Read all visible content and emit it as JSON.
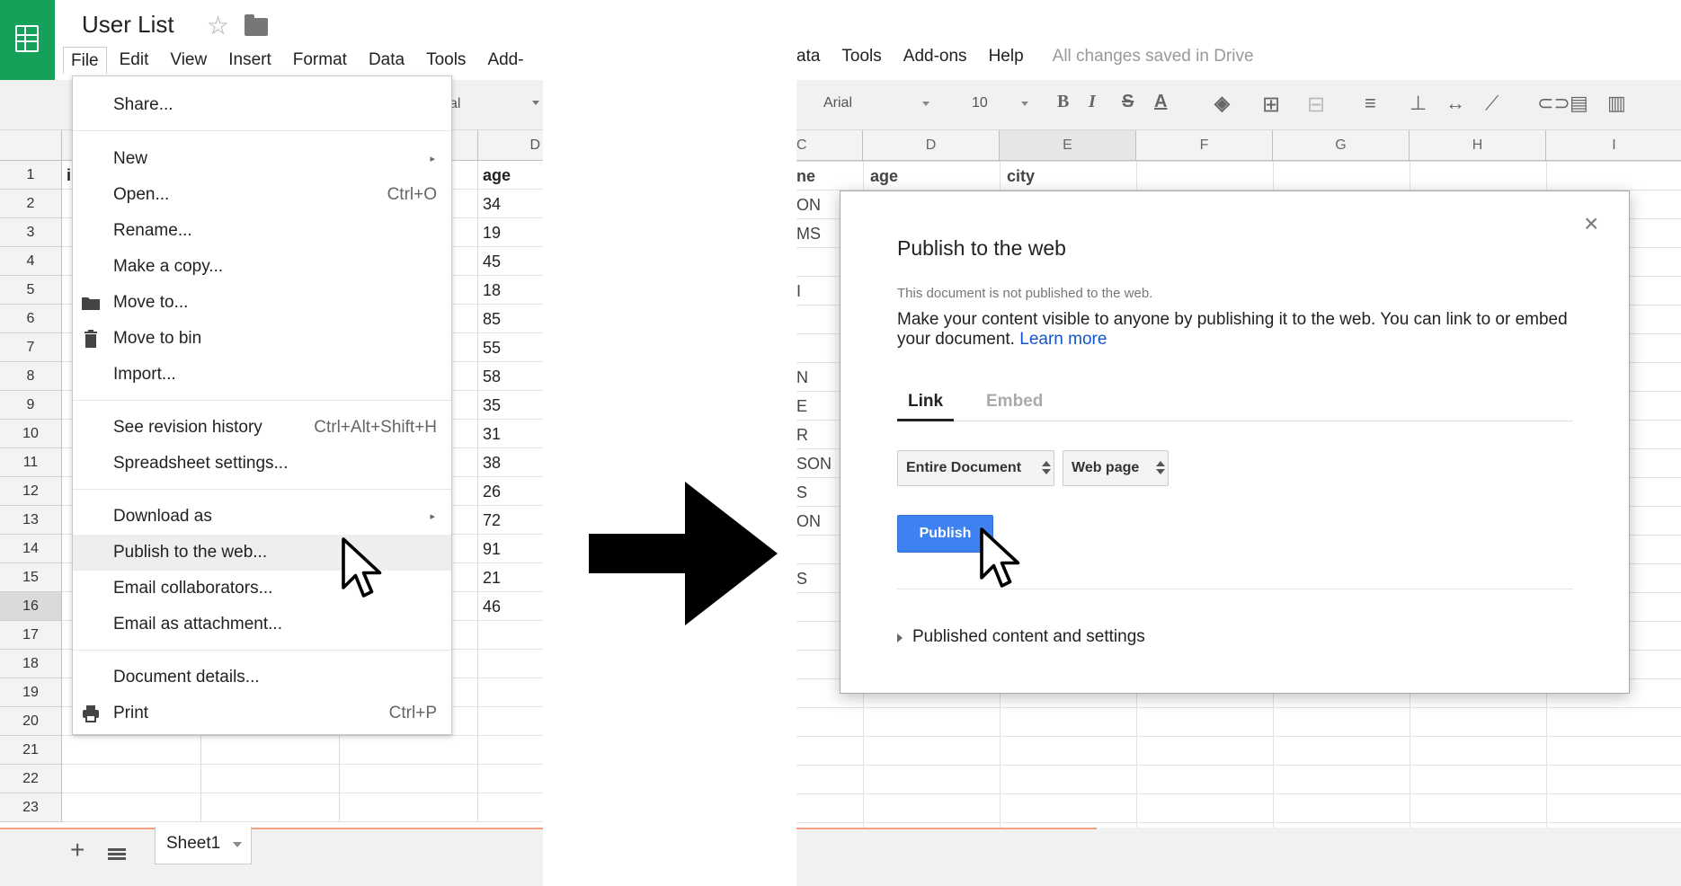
{
  "left": {
    "doc_title": "User List",
    "menubar": [
      "File",
      "Edit",
      "View",
      "Insert",
      "Format",
      "Data",
      "Tools",
      "Add-"
    ],
    "font_fragment": "al",
    "col_d_header": "D",
    "row_numbers": [
      "1",
      "2",
      "3",
      "4",
      "5",
      "6",
      "7",
      "8",
      "9",
      "10",
      "11",
      "12",
      "13",
      "14",
      "15",
      "16",
      "17",
      "18",
      "19",
      "20",
      "21",
      "22",
      "23"
    ],
    "col_a_fragment": "i",
    "age_header": "age",
    "ages": [
      "34",
      "19",
      "45",
      "18",
      "85",
      "55",
      "58",
      "35",
      "31",
      "38",
      "26",
      "72",
      "91",
      "21",
      "46"
    ],
    "sheet_tab": "Sheet1",
    "file_menu": {
      "share": "Share...",
      "new": "New",
      "open": "Open...",
      "open_shortcut": "Ctrl+O",
      "rename": "Rename...",
      "make_copy": "Make a copy...",
      "move_to": "Move to...",
      "move_to_bin": "Move to bin",
      "import": "Import...",
      "revision_history": "See revision history",
      "revision_shortcut": "Ctrl+Alt+Shift+H",
      "spreadsheet_settings": "Spreadsheet settings...",
      "download_as": "Download as",
      "publish": "Publish to the web...",
      "email_collaborators": "Email collaborators...",
      "email_attachment": "Email as attachment...",
      "document_details": "Document details...",
      "print": "Print",
      "print_shortcut": "Ctrl+P"
    }
  },
  "right": {
    "menubar": [
      "ata",
      "Tools",
      "Add-ons",
      "Help"
    ],
    "saved_status": "All changes saved in Drive",
    "font": "Arial",
    "font_size": "10",
    "columns": [
      "C",
      "D",
      "E",
      "F",
      "G",
      "H",
      "I"
    ],
    "row1": [
      "ne",
      "age",
      "city"
    ],
    "partial_cells": [
      "ON",
      "MS",
      "I",
      "N",
      "E",
      "R",
      "SON",
      "S",
      "ON",
      "S"
    ],
    "dialog": {
      "title": "Publish to the web",
      "status": "This document is not published to the web.",
      "description": "Make your content visible to anyone by publishing it to the web. You can link to or embed your document.",
      "learn_more": "Learn more",
      "tab_link": "Link",
      "tab_embed": "Embed",
      "select_scope": "Entire Document",
      "select_format": "Web page",
      "publish_button": "Publish",
      "published_settings": "Published content and settings",
      "close": "×"
    }
  },
  "colors": {
    "sheets_green": "#16a15a",
    "publish_blue": "#3d82f0",
    "link_blue": "#1155cc"
  }
}
